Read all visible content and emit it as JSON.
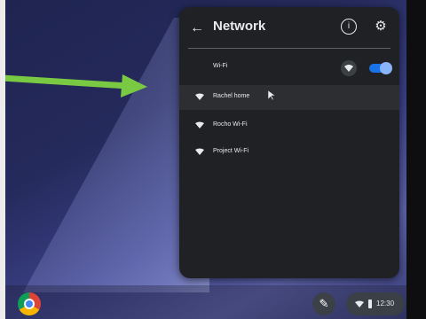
{
  "panel": {
    "title": "Network",
    "back_icon": "arrow-back-icon",
    "info_icon": "info-icon",
    "settings_icon": "gear-icon"
  },
  "wifi": {
    "label": "Wi-Fi",
    "enabled": true
  },
  "networks": [
    {
      "name": "Rachel home",
      "hovered": true
    },
    {
      "name": "Rocho Wi-Fi",
      "hovered": false
    },
    {
      "name": "Project Wi-Fi",
      "hovered": false
    }
  ],
  "tray": {
    "time": "12:30"
  },
  "colors": {
    "panel_bg": "#202124",
    "toggle_on": "#1a73e8",
    "arrow": "#7ac943"
  }
}
